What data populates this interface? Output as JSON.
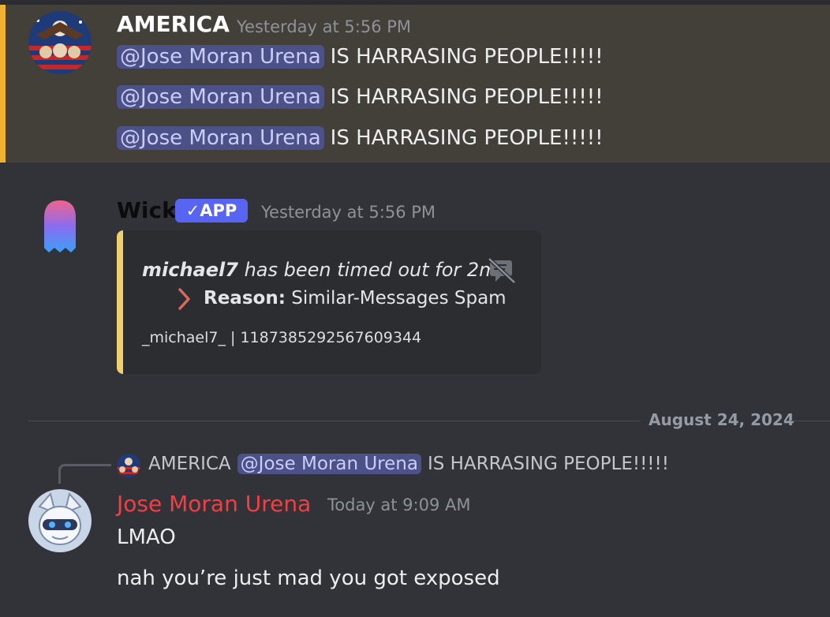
{
  "message1": {
    "username": "AMERICA",
    "timestamp": "Yesterday at 5:56 PM",
    "lines": [
      {
        "mention": "@Jose Moran Urena",
        "text": "IS HARRASING PEOPLE!!!!!"
      },
      {
        "mention": "@Jose Moran Urena",
        "text": "IS HARRASING PEOPLE!!!!!"
      },
      {
        "mention": "@Jose Moran Urena",
        "text": "IS HARRASING PEOPLE!!!!!"
      }
    ]
  },
  "message2": {
    "username": "Wick",
    "badge": "APP",
    "timestamp": "Yesterday at 5:56 PM",
    "embed": {
      "user": "michael7",
      "action": "has been timed out for 2m",
      "reason_label": "Reason:",
      "reason_value": "Similar-Messages Spam",
      "footer": "_michael7_ | 1187385292567609344",
      "accent": "#f0d06c"
    }
  },
  "divider": {
    "date": "August 24, 2024"
  },
  "message3": {
    "reply": {
      "username": "AMERICA",
      "mention": "@Jose Moran Urena",
      "text": "IS HARRASING PEOPLE!!!!!"
    },
    "username": "Jose Moran Urena",
    "username_color": "#f23f42",
    "timestamp": "Today at 9:09 AM",
    "lines": [
      "LMAO",
      "nah you’re just mad you got exposed"
    ]
  },
  "icons": {
    "timeout": "muted-chat-icon",
    "reason_arrow": "chevron-right-icon",
    "badge_check": "check-icon"
  },
  "colors": {
    "highlight_bar": "#f0b232",
    "mention_bg": "#4c5187",
    "app_badge": "#5865f2"
  }
}
